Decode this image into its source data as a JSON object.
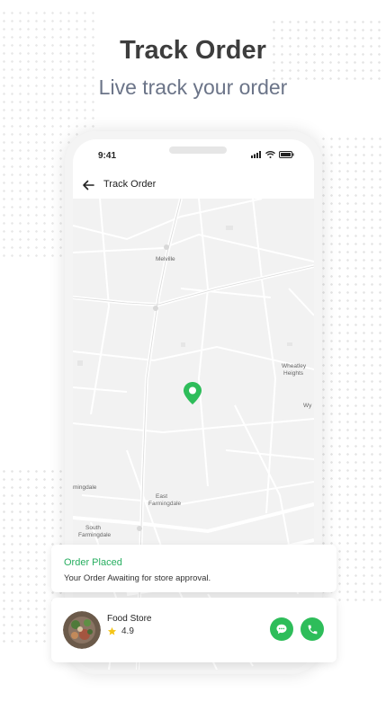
{
  "promo": {
    "headline": "Track Order",
    "subline": "Live track your order"
  },
  "phone": {
    "status_time": "9:41",
    "appbar_title": "Track Order"
  },
  "map": {
    "labels": {
      "melville": "Melville",
      "wheatley_1": "Wheatley",
      "wheatley_2": "Heights",
      "wy": "Wy",
      "mingdale": "mingdale",
      "east_farm_1": "East",
      "east_farm_2": "Farmingdale",
      "south_farm_1": "South",
      "south_farm_2": "Farmingdale"
    },
    "pin_color": "#2ebd5a"
  },
  "order_status": {
    "title": "Order Placed",
    "description": "Your Order Awaiting for store approval."
  },
  "store": {
    "name": "Food Store",
    "rating": "4.9"
  },
  "colors": {
    "accent": "#2ebd5a",
    "headline": "#3d3d3d",
    "subline": "#6b7488",
    "star": "#f5c518"
  },
  "icons": [
    "back-arrow-icon",
    "signal-icon",
    "wifi-icon",
    "battery-icon",
    "location-pin-icon",
    "star-icon",
    "chat-icon",
    "phone-icon"
  ]
}
